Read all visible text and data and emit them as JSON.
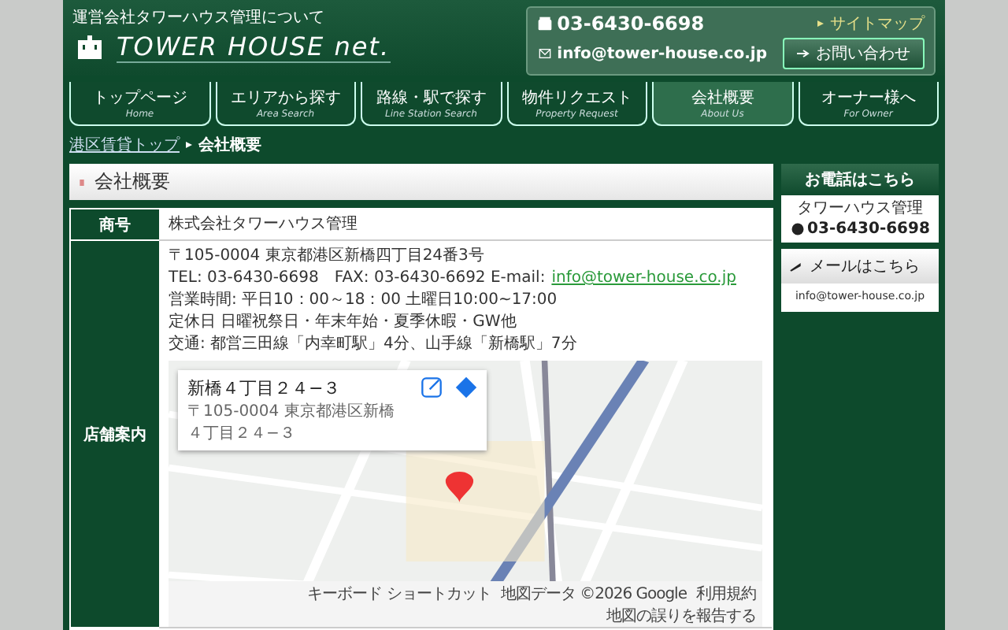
{
  "header": {
    "tagline": "運営会社タワーハウス管理について",
    "logo_text": "TOWER HOUSE net.",
    "phone": "03-6430-6698",
    "email": "info@tower-house.co.jp",
    "sitemap_link": "サイトマップ",
    "contact_button": "お問い合わせ"
  },
  "nav": [
    {
      "label": "トップページ",
      "sub": "Home",
      "selected": false
    },
    {
      "label": "エリアから探す",
      "sub": "Area Search",
      "selected": false
    },
    {
      "label": "路線・駅で探す",
      "sub": "Line Station Search",
      "selected": false
    },
    {
      "label": "物件リクエスト",
      "sub": "Property Request",
      "selected": false
    },
    {
      "label": "会社概要",
      "sub": "About Us",
      "selected": true
    },
    {
      "label": "オーナー様へ",
      "sub": "For Owner",
      "selected": false
    }
  ],
  "breadcrumb": [
    {
      "label": "港区賃貸トップ",
      "kind": "link"
    },
    {
      "label": "会社概要",
      "kind": "current"
    }
  ],
  "page_title": "会社概要",
  "table": {
    "rows": [
      {
        "label": "商号",
        "lines": [
          {
            "text": "株式会社タワーハウス管理"
          }
        ]
      },
      {
        "label": "店舗案内",
        "lines": [
          {
            "text": "〒105-0004 東京都港区新橋四丁目24番3号"
          },
          {
            "text": "TEL: 03-6430-6698　FAX: 03-6430-6692 E-mail:",
            "link": "info@tower-house.co.jp"
          },
          {
            "text": "営業時間: 平日10：00～18：00 土曜日10:00~17:00"
          },
          {
            "text": "定休日 日曜祝祭日・年末年始・夏季休暇・GW他"
          },
          {
            "text": "交通: 都営三田線「内幸町駅」4分、山手線「新橋駅」7分"
          }
        ],
        "map": {
          "place_title": "新橋４丁目２４−３",
          "place_address": "〒105-0004 東京都港区新橋４丁目２４−３",
          "footer": [
            "キーボード ショートカット",
            "地図データ ©2026 Google",
            "利用規約",
            "地図の誤りを報告する"
          ]
        }
      }
    ]
  },
  "sidebar": {
    "phone_heading": "お電話はこちら",
    "company": "タワーハウス管理",
    "phone": "03-6430-6698",
    "mail_heading": "メールはこちら",
    "email": "info@tower-house.co.jp"
  }
}
